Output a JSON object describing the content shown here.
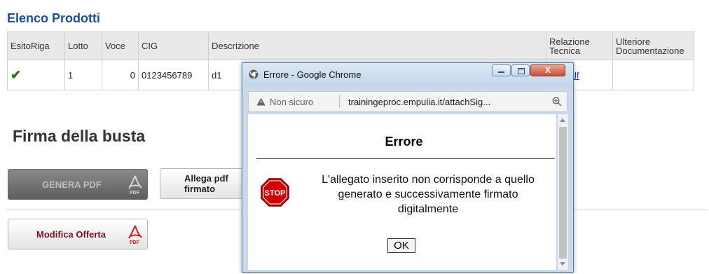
{
  "section_title": "Elenco Prodotti",
  "table": {
    "headers": [
      "EsitoRiga",
      "Lotto",
      "Voce",
      "CIG",
      "Descrizione",
      "Relazione Tecnica",
      "Ulteriore Documentazione"
    ],
    "row": {
      "esito": "✔",
      "lotto": "1",
      "voce": "0",
      "cig": "0123456789",
      "descrizione": "d1",
      "relazione": "test.pdf",
      "ulteriore": ""
    }
  },
  "firma": {
    "title": "Firma della busta",
    "genera_label": "GENERA PDF",
    "allega_label": "Allega pdf firmato",
    "modifica_label": "Modifica Offerta"
  },
  "popup": {
    "window_title": "Errore - Google Chrome",
    "close_glyph": "X",
    "security_label": "Non sicuro",
    "url": "trainingeproc.empulia.it/attachSig...",
    "heading": "Errore",
    "message": "L'allegato inserito non corrisponde a quello generato e successivamente firmato digitalmente",
    "ok_label": "OK",
    "stop_text": "STOP"
  },
  "icons": {
    "pdf": "pdf-icon",
    "stop": "stop-icon",
    "check": "check-icon",
    "warning": "warning-icon",
    "zoom": "zoom-icon",
    "chrome": "chrome-icon"
  },
  "colors": {
    "title_blue": "#1f4e96",
    "link_blue": "#1a3fb5",
    "check_green": "#2f6b1c",
    "pdf_red": "#cc1a1a",
    "stop_red": "#cc0000"
  }
}
